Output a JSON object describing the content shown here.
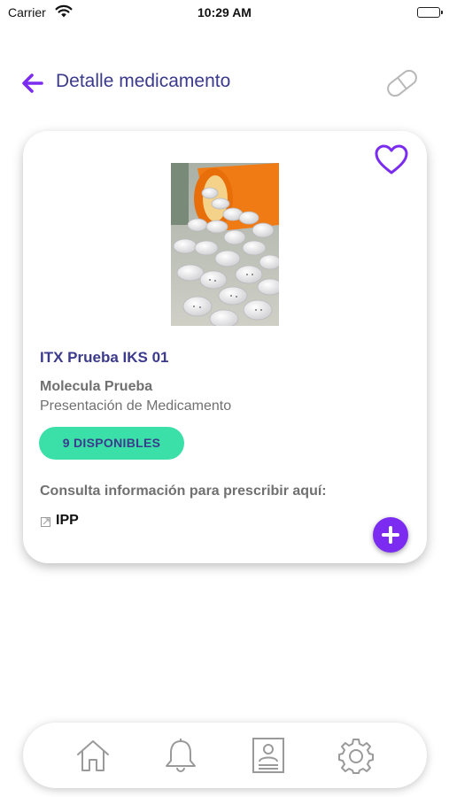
{
  "status_bar": {
    "carrier": "Carrier",
    "time": "10:29 AM",
    "icons": [
      "wifi-icon",
      "battery-icon"
    ]
  },
  "header": {
    "title": "Detalle medicamento",
    "back_icon": "arrow-left-icon",
    "action_icon": "pill-icon"
  },
  "card": {
    "favorite_icon": "heart-outline-icon",
    "image_alt": "pills spilling from orange bottle",
    "name": "ITX Prueba IKS 01",
    "molecule": "Molecula Prueba",
    "presentation": "Presentación de Medicamento",
    "availability_badge": "9 DISPONIBLES",
    "prescribe_info": "Consulta información para prescribir aquí:",
    "link": {
      "label": "IPP",
      "icon": "external-link-icon"
    },
    "add_icon": "plus-circle-icon"
  },
  "bottom_nav": {
    "items": [
      {
        "icon": "home-icon"
      },
      {
        "icon": "bell-icon"
      },
      {
        "icon": "id-card-icon"
      },
      {
        "icon": "gear-icon"
      }
    ]
  },
  "colors": {
    "primary": "#3b3a8c",
    "accent": "#7b2cf0",
    "badge": "#3be0a9",
    "muted_text": "#707070"
  }
}
